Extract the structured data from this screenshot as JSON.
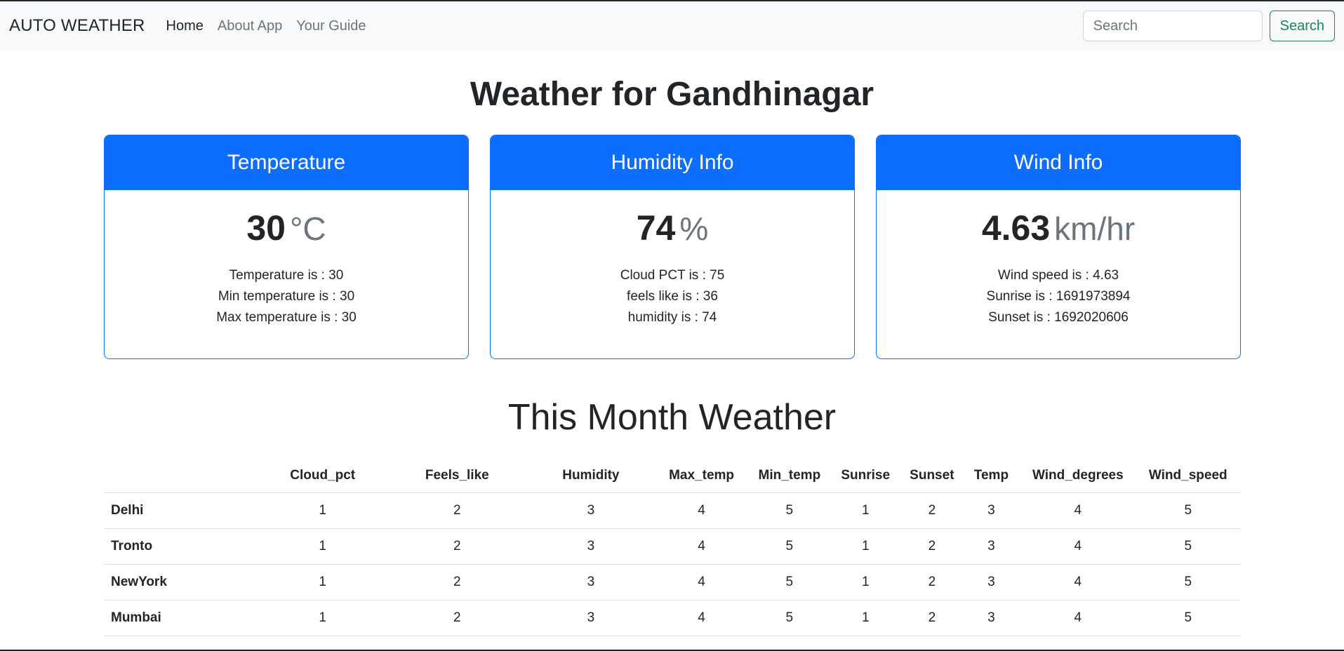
{
  "navbar": {
    "brand": "AUTO WEATHER",
    "links": [
      {
        "label": "Home",
        "active": true
      },
      {
        "label": "About App",
        "active": false
      },
      {
        "label": "Your Guide",
        "active": false
      }
    ],
    "search": {
      "placeholder": "Search",
      "value": "",
      "button_label": "Search"
    }
  },
  "main": {
    "title": "Weather for Gandhinagar",
    "cards": [
      {
        "header": "Temperature",
        "value": "30",
        "unit": "°C",
        "lines": [
          "Temperature is : 30",
          "Min temperature is : 30",
          "Max temperature is : 30"
        ]
      },
      {
        "header": "Humidity Info",
        "value": "74",
        "unit": "%",
        "lines": [
          "Cloud PCT is : 75",
          "feels like is : 36",
          "humidity is : 74"
        ]
      },
      {
        "header": "Wind Info",
        "value": "4.63",
        "unit": "km/hr",
        "lines": [
          "Wind speed is : 4.63",
          "Sunrise is : 1691973894",
          "Sunset is : 1692020606"
        ]
      }
    ],
    "section_title": "This Month Weather",
    "table": {
      "columns": [
        "",
        "Cloud_pct",
        "Feels_like",
        "Humidity",
        "Max_temp",
        "Min_temp",
        "Sunrise",
        "Sunset",
        "Temp",
        "Wind_degrees",
        "Wind_speed"
      ],
      "rows": [
        {
          "city": "Delhi",
          "values": [
            "1",
            "2",
            "3",
            "4",
            "5",
            "1",
            "2",
            "3",
            "4",
            "5"
          ]
        },
        {
          "city": "Tronto",
          "values": [
            "1",
            "2",
            "3",
            "4",
            "5",
            "1",
            "2",
            "3",
            "4",
            "5"
          ]
        },
        {
          "city": "NewYork",
          "values": [
            "1",
            "2",
            "3",
            "4",
            "5",
            "1",
            "2",
            "3",
            "4",
            "5"
          ]
        },
        {
          "city": "Mumbai",
          "values": [
            "1",
            "2",
            "3",
            "4",
            "5",
            "1",
            "2",
            "3",
            "4",
            "5"
          ]
        }
      ]
    }
  },
  "colors": {
    "primary": "#0d6efd",
    "success": "#198754",
    "navbar_bg": "#f8f9fa",
    "muted": "#6c757d"
  }
}
